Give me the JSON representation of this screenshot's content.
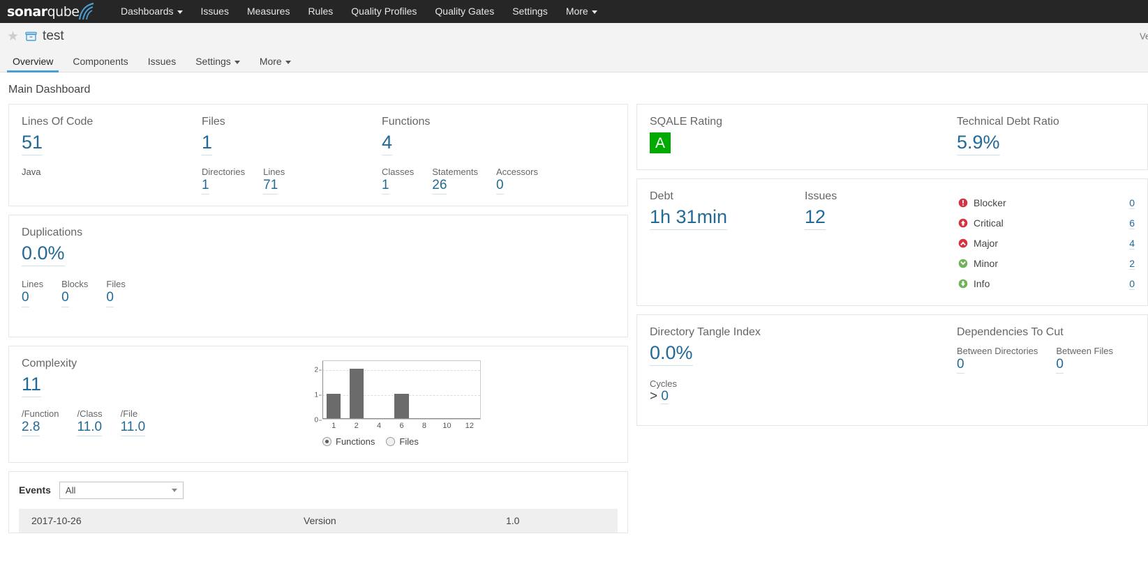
{
  "navbar": {
    "logo": {
      "bold": "sonar",
      "light": "qube"
    },
    "items": [
      {
        "label": "Dashboards",
        "caret": true
      },
      {
        "label": "Issues",
        "caret": false
      },
      {
        "label": "Measures",
        "caret": false
      },
      {
        "label": "Rules",
        "caret": false
      },
      {
        "label": "Quality Profiles",
        "caret": false
      },
      {
        "label": "Quality Gates",
        "caret": false
      },
      {
        "label": "Settings",
        "caret": false
      },
      {
        "label": "More",
        "caret": true
      }
    ]
  },
  "project": {
    "name": "test",
    "right_clipped_text": "Vers",
    "tabs": [
      {
        "label": "Overview",
        "active": true,
        "caret": false
      },
      {
        "label": "Components",
        "active": false,
        "caret": false
      },
      {
        "label": "Issues",
        "active": false,
        "caret": false
      },
      {
        "label": "Settings",
        "active": false,
        "caret": true
      },
      {
        "label": "More",
        "active": false,
        "caret": true
      }
    ]
  },
  "dashboard": {
    "title": "Main Dashboard"
  },
  "size_card": {
    "lines_of_code": {
      "label": "Lines Of Code",
      "value": "51"
    },
    "language": "Java",
    "files": {
      "label": "Files",
      "value": "1"
    },
    "files_subs": [
      {
        "label": "Directories",
        "value": "1"
      },
      {
        "label": "Lines",
        "value": "71"
      }
    ],
    "functions": {
      "label": "Functions",
      "value": "4"
    },
    "functions_subs": [
      {
        "label": "Classes",
        "value": "1"
      },
      {
        "label": "Statements",
        "value": "26"
      },
      {
        "label": "Accessors",
        "value": "0"
      }
    ]
  },
  "duplications_card": {
    "label": "Duplications",
    "value": "0.0%",
    "subs": [
      {
        "label": "Lines",
        "value": "0"
      },
      {
        "label": "Blocks",
        "value": "0"
      },
      {
        "label": "Files",
        "value": "0"
      }
    ]
  },
  "complexity_card": {
    "label": "Complexity",
    "value": "11",
    "subs": [
      {
        "label": "/Function",
        "value": "2.8"
      },
      {
        "label": "/Class",
        "value": "11.0"
      },
      {
        "label": "/File",
        "value": "11.0"
      }
    ],
    "radios": [
      {
        "label": "Functions",
        "selected": true
      },
      {
        "label": "Files",
        "selected": false
      }
    ]
  },
  "chart_data": {
    "type": "bar",
    "title": "",
    "xlabel": "",
    "ylabel": "",
    "categories": [
      "1",
      "2",
      "4",
      "6",
      "8",
      "10",
      "12"
    ],
    "values": [
      1,
      2,
      0,
      1,
      0,
      0,
      0
    ],
    "yticks": [
      "0",
      "1",
      "2"
    ],
    "ylim": [
      0,
      2.35
    ],
    "grid": true,
    "legend_position": "bottom",
    "series": [
      {
        "name": "Functions",
        "values": [
          1,
          2,
          0,
          1,
          0,
          0,
          0
        ]
      }
    ]
  },
  "events_card": {
    "label": "Events",
    "filter_value": "All",
    "rows": [
      {
        "date": "2017-10-26",
        "type": "Version",
        "name": "1.0"
      }
    ]
  },
  "sqale_card": {
    "rating": {
      "label": "SQALE Rating",
      "value": "A",
      "color": "#00aa00"
    },
    "debt_ratio": {
      "label": "Technical Debt Ratio",
      "value": "5.9%"
    }
  },
  "issues_card": {
    "debt": {
      "label": "Debt",
      "value": "1h 31min"
    },
    "issues": {
      "label": "Issues",
      "value": "12"
    },
    "severities": [
      {
        "icon": "blocker-icon",
        "label": "Blocker",
        "count": "0"
      },
      {
        "icon": "critical-icon",
        "label": "Critical",
        "count": "6"
      },
      {
        "icon": "major-icon",
        "label": "Major",
        "count": "4"
      },
      {
        "icon": "minor-icon",
        "label": "Minor",
        "count": "2"
      },
      {
        "icon": "info-icon",
        "label": "Info",
        "count": "0"
      }
    ]
  },
  "design_card": {
    "tangle": {
      "label": "Directory Tangle Index",
      "value": "0.0%"
    },
    "cycles": {
      "label": "Cycles",
      "prefix": ">",
      "value": "0"
    },
    "dependencies": {
      "label": "Dependencies To Cut",
      "items": [
        {
          "label": "Between Directories",
          "value": "0"
        },
        {
          "label": "Between Files",
          "value": "0"
        }
      ]
    }
  }
}
